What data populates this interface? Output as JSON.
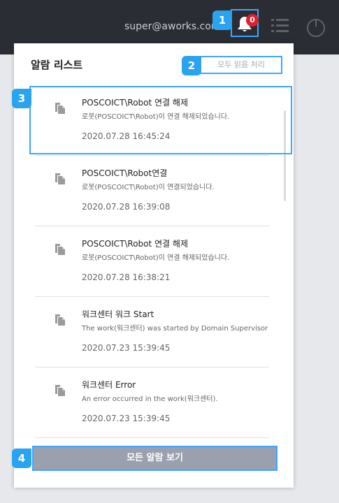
{
  "header": {
    "email": "super@aworks.com",
    "notification_count": "0"
  },
  "callouts": [
    "1",
    "2",
    "3",
    "4"
  ],
  "alarm_panel": {
    "title": "알람 리스트",
    "read_all_label": "모두 읽음 처리",
    "view_all_label": "모든 알람 보기",
    "items": [
      {
        "title": "POSCOICT\\Robot 연결 해제",
        "desc": "로봇(POSCOICT\\Robot)이 연결 해제되었습니다.",
        "time": "2020.07.28 16:45:24"
      },
      {
        "title": "POSCOICT\\Robot연결",
        "desc": "로봇(POSCOICT\\Robot)이 연결되었습니다.",
        "time": "2020.07.28 16:39:08"
      },
      {
        "title": "POSCOICT\\Robot 연결 해제",
        "desc": "로봇(POSCOICT\\Robot)이 연결 해제되었습니다.",
        "time": "2020.07.28 16:38:21"
      },
      {
        "title": "워크센터 워크 Start",
        "desc": "The work(워크센터) was started by Domain Supervisor",
        "time": "2020.07.23 15:39:45"
      },
      {
        "title": "워크센터 Error",
        "desc": "An error occurred in the work(워크센터).",
        "time": "2020.07.23 15:39:45"
      }
    ]
  },
  "colors": {
    "topbar": "#2a2d33",
    "callout": "#2aa4ee",
    "badge": "#e01e2c",
    "view_all_button": "#9aa0ad"
  }
}
